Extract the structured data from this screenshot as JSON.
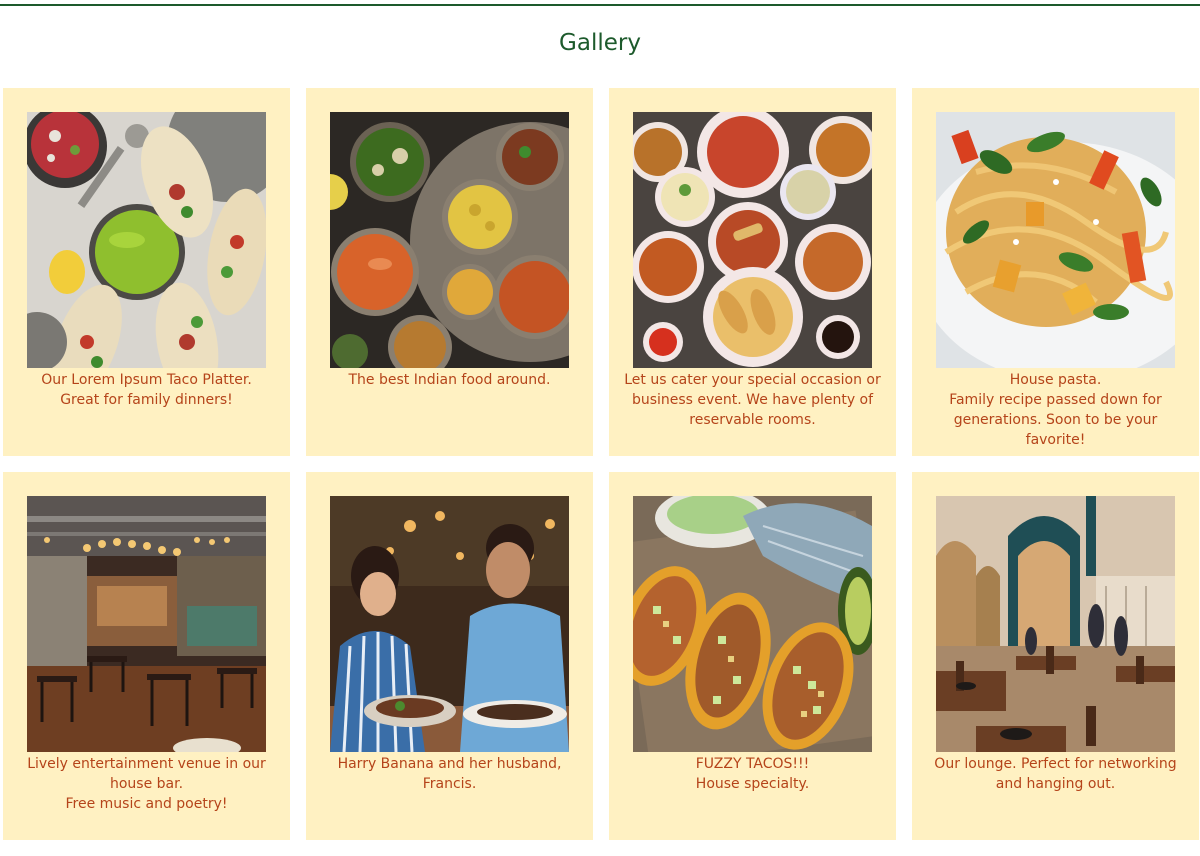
{
  "page": {
    "title": "Gallery",
    "accent_color": "#1d5a2c",
    "card_background": "#fff1c2",
    "caption_color": "#b5441a"
  },
  "gallery": {
    "items": [
      {
        "image": "taco-platter-photo",
        "caption": [
          "Our Lorem Ipsum Taco Platter.",
          "Great for family dinners!"
        ]
      },
      {
        "image": "indian-food-photo",
        "caption": [
          "The best Indian food around."
        ]
      },
      {
        "image": "catering-spread-photo",
        "caption": [
          "Let us cater your special occasion or business event. We have plenty of reservable rooms."
        ]
      },
      {
        "image": "house-pasta-photo",
        "caption": [
          "House pasta.",
          "Family recipe passed down for generations. Soon to be your favorite!"
        ]
      },
      {
        "image": "entertainment-venue-photo",
        "caption": [
          "Lively entertainment venue in our house bar.",
          "Free music and poetry!"
        ]
      },
      {
        "image": "couple-dining-photo",
        "caption": [
          "Harry Banana and her husband, Francis."
        ]
      },
      {
        "image": "fuzzy-tacos-photo",
        "caption": [
          "FUZZY TACOS!!!",
          "House specialty."
        ]
      },
      {
        "image": "lounge-photo",
        "caption": [
          "Our lounge. Perfect for networking and hanging out."
        ]
      }
    ]
  }
}
